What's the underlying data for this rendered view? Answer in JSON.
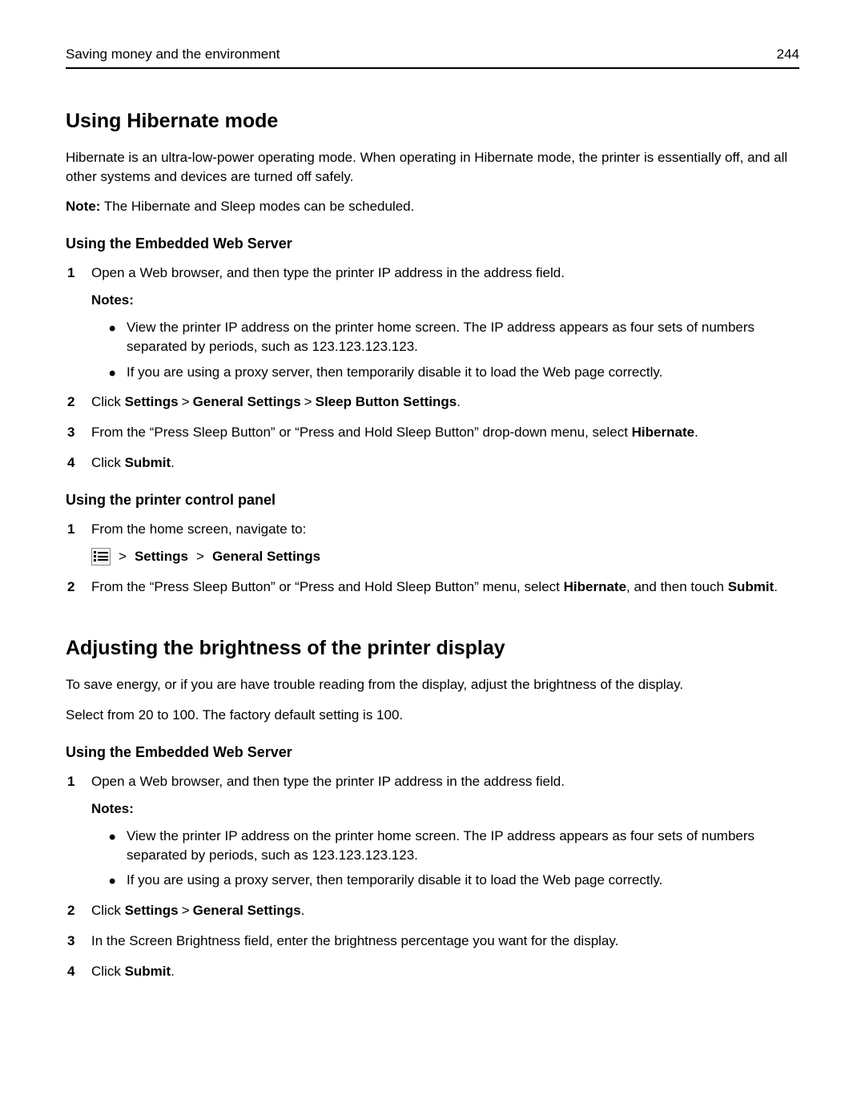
{
  "header": {
    "title": "Saving money and the environment",
    "page": "244"
  },
  "s1": {
    "title": "Using Hibernate mode",
    "intro": "Hibernate is an ultra-low-power operating mode. When operating in Hibernate mode, the printer is essentially off, and all other systems and devices are turned off safely.",
    "note_label": "Note:",
    "note_text": " The Hibernate and Sleep modes can be scheduled.",
    "sub1": "Using the Embedded Web Server",
    "step1": "Open a Web browser, and then type the printer IP address in the address field.",
    "notes_label": "Notes:",
    "bullet1": "View the printer IP address on the printer home screen. The IP address appears as four sets of numbers separated by periods, such as 123.123.123.123.",
    "bullet2": "If you are using a proxy server, then temporarily disable it to load the Web page correctly.",
    "step2_pre": "Click ",
    "step2_b1": "Settings",
    "step2_b2": "General Settings",
    "step2_b3": "Sleep Button Settings",
    "step3_pre": "From the “Press Sleep Button” or “Press and Hold Sleep Button” drop-down menu, select ",
    "step3_b": "Hibernate",
    "step4_pre": "Click ",
    "step4_b": "Submit",
    "sub2": "Using the printer control panel",
    "cp1": "From the home screen, navigate to:",
    "cp_b1": "Settings",
    "cp_b2": "General Settings",
    "cp2_pre": "From the “Press Sleep Button” or “Press and Hold Sleep Button” menu, select ",
    "cp2_b1": "Hibernate",
    "cp2_mid": ", and then touch ",
    "cp2_b2": "Submit"
  },
  "s2": {
    "title": "Adjusting the brightness of the printer display",
    "p1": "To save energy, or if you are have trouble reading from the display, adjust the brightness of the display.",
    "p2": "Select from 20 to 100. The factory default setting is 100.",
    "sub1": "Using the Embedded Web Server",
    "step1": "Open a Web browser, and then type the printer IP address in the address field.",
    "notes_label": "Notes:",
    "bullet1": "View the printer IP address on the printer home screen. The IP address appears as four sets of numbers separated by periods, such as 123.123.123.123.",
    "bullet2": "If you are using a proxy server, then temporarily disable it to load the Web page correctly.",
    "step2_pre": "Click ",
    "step2_b1": "Settings",
    "step2_b2": "General Settings",
    "step3": "In the Screen Brightness field, enter the brightness percentage you want for the display.",
    "step4_pre": "Click ",
    "step4_b": "Submit"
  },
  "chev": ">"
}
